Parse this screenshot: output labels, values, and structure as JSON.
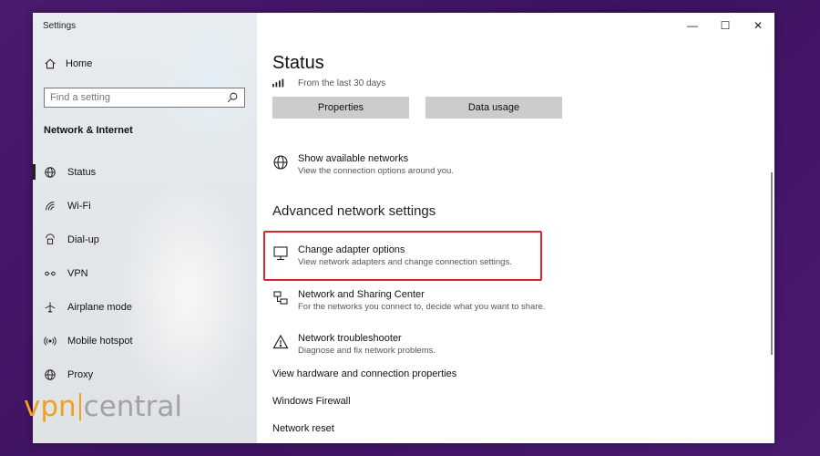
{
  "window": {
    "title": "Settings"
  },
  "titlebar": {
    "minimize": "—",
    "maximize": "☐",
    "close": "✕"
  },
  "sidebar": {
    "home_label": "Home",
    "search_placeholder": "Find a setting",
    "section_title": "Network & Internet",
    "items": [
      {
        "label": "Status",
        "icon": "globe-icon",
        "selected": true
      },
      {
        "label": "Wi-Fi",
        "icon": "wifi-icon"
      },
      {
        "label": "Dial-up",
        "icon": "dialup-icon"
      },
      {
        "label": "VPN",
        "icon": "vpn-icon"
      },
      {
        "label": "Airplane mode",
        "icon": "airplane-icon"
      },
      {
        "label": "Mobile hotspot",
        "icon": "hotspot-icon"
      },
      {
        "label": "Proxy",
        "icon": "proxy-globe-icon"
      }
    ]
  },
  "main": {
    "title": "Status",
    "usage_text": "From the last 30 days",
    "buttons": {
      "properties": "Properties",
      "data_usage": "Data usage"
    },
    "show_networks": {
      "title": "Show available networks",
      "desc": "View the connection options around you."
    },
    "advanced_title": "Advanced network settings",
    "change_adapter": {
      "title": "Change adapter options",
      "desc": "View network adapters and change connection settings."
    },
    "sharing_center": {
      "title": "Network and Sharing Center",
      "desc": "For the networks you connect to, decide what you want to share."
    },
    "troubleshooter": {
      "title": "Network troubleshooter",
      "desc": "Diagnose and fix network problems."
    },
    "links": [
      "View hardware and connection properties",
      "Windows Firewall",
      "Network reset"
    ]
  },
  "watermark": {
    "brand_left": "vpn",
    "brand_right": "central"
  },
  "colors": {
    "highlight": "#d9232e",
    "button": "#cccccc",
    "watermark_accent": "#f0a21e",
    "background": "#4a1a6e"
  }
}
